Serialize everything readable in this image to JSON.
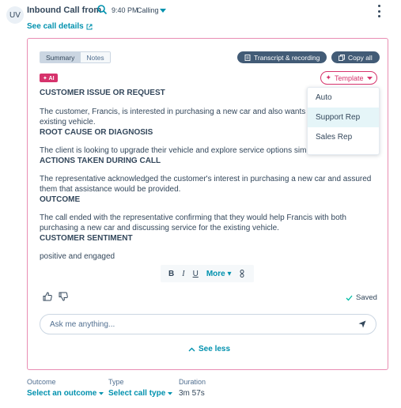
{
  "header": {
    "avatar_initials": "UV",
    "title": "Inbound Call from",
    "time": "9:40 PM",
    "status": "Calling",
    "see_details": "See call details"
  },
  "card": {
    "tabs": [
      "Summary",
      "Notes"
    ],
    "transcript_btn": "Transcript & recording",
    "copy_btn": "Copy all",
    "ai_badge": "✦ AI",
    "template_btn": "Template",
    "sections": [
      {
        "heading": "CUSTOMER ISSUE OR REQUEST",
        "text": "The customer, Francis, is interested in purchasing a new car and also wants to options for their existing vehicle."
      },
      {
        "heading": "ROOT CAUSE OR DIAGNOSIS",
        "text": "The client is looking to upgrade their vehicle and explore service options simult"
      },
      {
        "heading": "ACTIONS TAKEN DURING CALL",
        "text": "The representative acknowledged the customer's interest in purchasing a new car and assured them that assistance would be provided."
      },
      {
        "heading": "OUTCOME",
        "text": "The call ended with the representative confirming that they would help Francis with both purchasing a new car and discussing service for the existing vehicle."
      },
      {
        "heading": "CUSTOMER SENTIMENT",
        "text": "positive and engaged"
      }
    ],
    "template_options": [
      "Auto",
      "Support Rep",
      "Sales Rep"
    ],
    "toolbar": {
      "bold": "B",
      "italic": "I",
      "underline": "U",
      "more": "More"
    },
    "saved": "Saved",
    "ask_placeholder": "Ask me anything...",
    "see_less": "See less"
  },
  "footer": {
    "outcome_label": "Outcome",
    "outcome_value": "Select an outcome",
    "type_label": "Type",
    "type_value": "Select call type",
    "duration_label": "Duration",
    "duration_value": "3m 57s"
  },
  "colors": {
    "accent": "#0091ae",
    "ai_pink": "#d6336c",
    "pill_dark": "#425b76"
  }
}
